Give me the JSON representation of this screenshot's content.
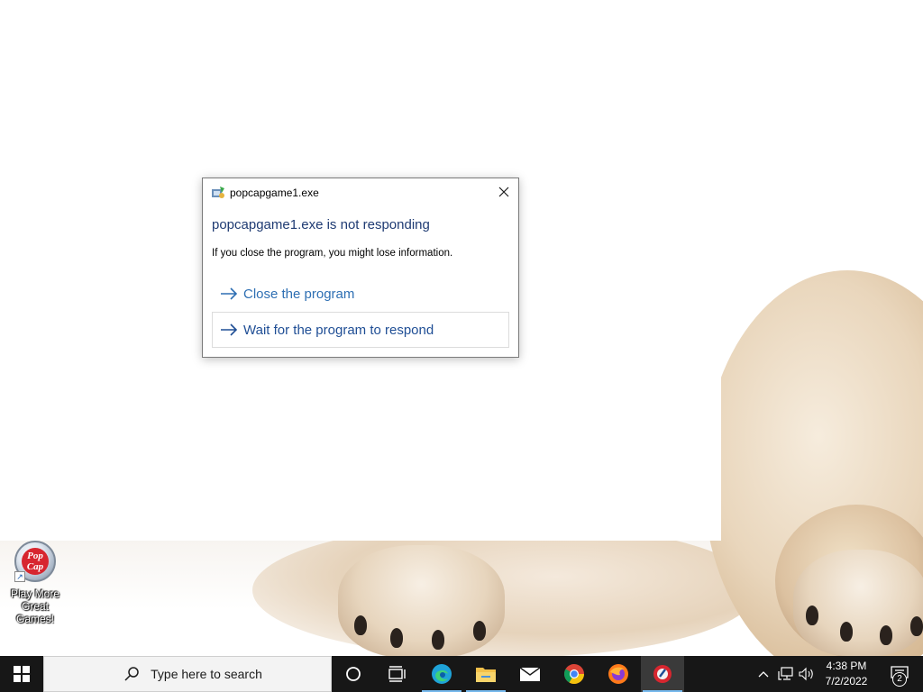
{
  "desktop": {
    "icons": [
      {
        "label": "Play More Great Games!",
        "logo_text": "Pop Cap",
        "icon": "popcap-icon"
      }
    ]
  },
  "dialog": {
    "title": "popcapgame1.exe",
    "heading": "popcapgame1.exe is not responding",
    "info": "If you close the program, you might lose information.",
    "options": [
      {
        "label": "Close the program"
      },
      {
        "label": "Wait for the program to respond"
      }
    ],
    "accent_color": "#1f4e95"
  },
  "taskbar": {
    "search_placeholder": "Type here to search",
    "pinned": [
      "start-icon",
      "cortana-icon",
      "task-view-icon",
      "edge-icon",
      "file-explorer-icon",
      "mail-icon",
      "chrome-icon",
      "firefox-icon",
      "popcap-game-icon"
    ],
    "active_app": "popcap-game-icon",
    "clock": {
      "time": "4:38 PM",
      "date": "7/2/2022"
    },
    "notifications_count": "2"
  }
}
